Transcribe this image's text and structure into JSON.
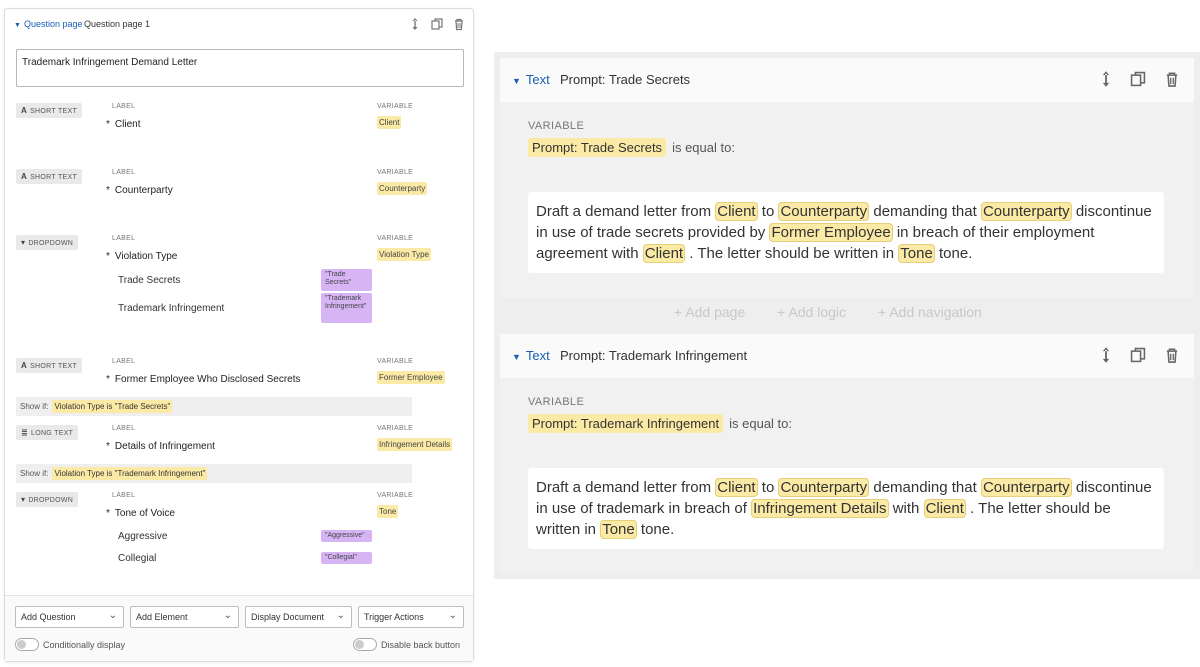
{
  "left": {
    "header": {
      "toggle_label": "Question page",
      "title": "Question page 1"
    },
    "page_title": "Trademark Infringement Demand Letter",
    "caption_label": "LABEL",
    "caption_variable": "VARIABLE",
    "show_if_label": "Show if:",
    "questions": [
      {
        "type": "SHORT TEXT",
        "type_icon": "A",
        "label": "Client",
        "variable": "Client"
      },
      {
        "type": "SHORT TEXT",
        "type_icon": "A",
        "label": "Counterparty",
        "variable": "Counterparty"
      },
      {
        "type": "DROPDOWN",
        "type_icon": "▾",
        "label": "Violation Type",
        "variable": "Violation Type",
        "options": [
          {
            "label": "Trade Secrets",
            "value": "\"Trade Secrets\""
          },
          {
            "label": "Trademark Infringement",
            "value": "\"Trademark Infringement\""
          }
        ]
      },
      {
        "type": "SHORT TEXT",
        "type_icon": "A",
        "label": "Former Employee Who Disclosed Secrets",
        "variable": "Former Employee",
        "show_if": "Violation Type is \"Trade Secrets\""
      },
      {
        "type": "LONG TEXT",
        "type_icon": "≣",
        "label": "Details of Infringement",
        "variable": "Infringement Details",
        "show_if": "Violation Type is \"Trademark Infringement\""
      },
      {
        "type": "DROPDOWN",
        "type_icon": "▾",
        "label": "Tone of Voice",
        "variable": "Tone",
        "options": [
          {
            "label": "Aggressive",
            "value": "\"Aggressive\""
          },
          {
            "label": "Collegial",
            "value": "\"Collegial\""
          }
        ]
      }
    ],
    "footer": {
      "selects": [
        "Add Question",
        "Add Element",
        "Display Document",
        "Trigger Actions"
      ],
      "conditionally_display": "Conditionally display",
      "disable_back": "Disable back button"
    }
  },
  "right": {
    "blocks": [
      {
        "toggle_label": "Text",
        "title": "Prompt: Trade Secrets",
        "variable_caption": "VARIABLE",
        "variable": "Prompt: Trade Secrets",
        "eq_text": "is equal to:",
        "tokens": [
          "Client",
          "Counterparty",
          "Counterparty",
          "Former Employee",
          "Client",
          "Tone"
        ],
        "segments": [
          "Draft a demand letter from",
          "to",
          "demanding that",
          "discontinue in use of trade secrets provided by",
          "in breach of their employment agreement with",
          ". The letter should be written in",
          "tone."
        ]
      },
      {
        "toggle_label": "Text",
        "title": "Prompt: Trademark Infringement",
        "variable_caption": "VARIABLE",
        "variable": "Prompt: Trademark Infringement",
        "eq_text": "is equal to:",
        "tokens": [
          "Client",
          "Counterparty",
          "Counterparty",
          "Infringement Details",
          "Client",
          "Tone"
        ],
        "segments": [
          "Draft a demand letter from",
          "to",
          "demanding that",
          "discontinue in use of trademark in breach of",
          "with",
          ". The letter should be written in",
          "tone."
        ]
      }
    ],
    "ghost_actions": [
      "+ Add page",
      "+ Add logic",
      "+ Add navigation"
    ]
  },
  "colors": {
    "accent": "#1a5fb4",
    "variable_chip": "#fbeaa5",
    "option_chip": "#d7b5f5"
  }
}
